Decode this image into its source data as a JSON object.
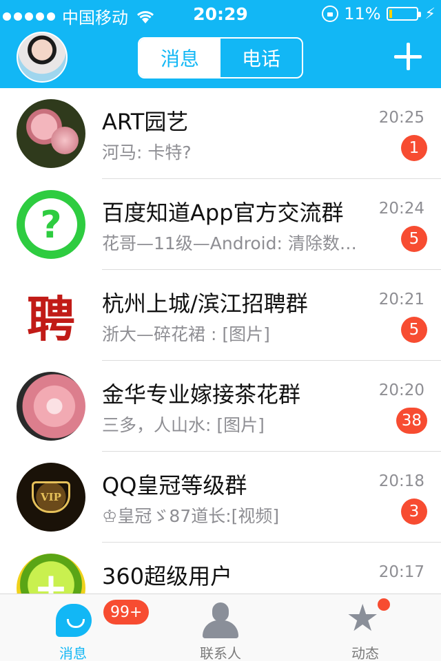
{
  "status_bar": {
    "carrier": "中国移动",
    "time": "20:29",
    "battery_percent": "11%",
    "battery_level": 0.11
  },
  "header": {
    "segment": {
      "active": "消息",
      "inactive": "电话"
    }
  },
  "conversations": [
    {
      "name": "ART园艺",
      "message": "河马: 卡特?",
      "time": "20:25",
      "badge": "1"
    },
    {
      "name": "百度知道App官方交流群",
      "message": "花哥—11级—Android: 清除数…",
      "time": "20:24",
      "badge": "5"
    },
    {
      "name": "杭州上城/滨江招聘群",
      "message": "浙大—碎花裙 : [图片]",
      "time": "20:21",
      "badge": "5",
      "avatar_char": "聘"
    },
    {
      "name": "金华专业嫁接茶花群",
      "message": "三多，人山水: [图片]",
      "time": "20:20",
      "badge": "38"
    },
    {
      "name": "QQ皇冠等级群",
      "message": "♔皇冠ゞ87道长:[视频]",
      "time": "20:18",
      "badge": "3",
      "avatar_text": "VIP"
    },
    {
      "name": "360超级用户",
      "message": "",
      "time": "20:17",
      "badge": ""
    }
  ],
  "tabbar": {
    "messages": {
      "label": "消息",
      "badge": "99+"
    },
    "contacts": {
      "label": "联系人"
    },
    "moments": {
      "label": "动态"
    }
  },
  "colors": {
    "accent": "#12b7f5",
    "badge": "#f74c31"
  }
}
